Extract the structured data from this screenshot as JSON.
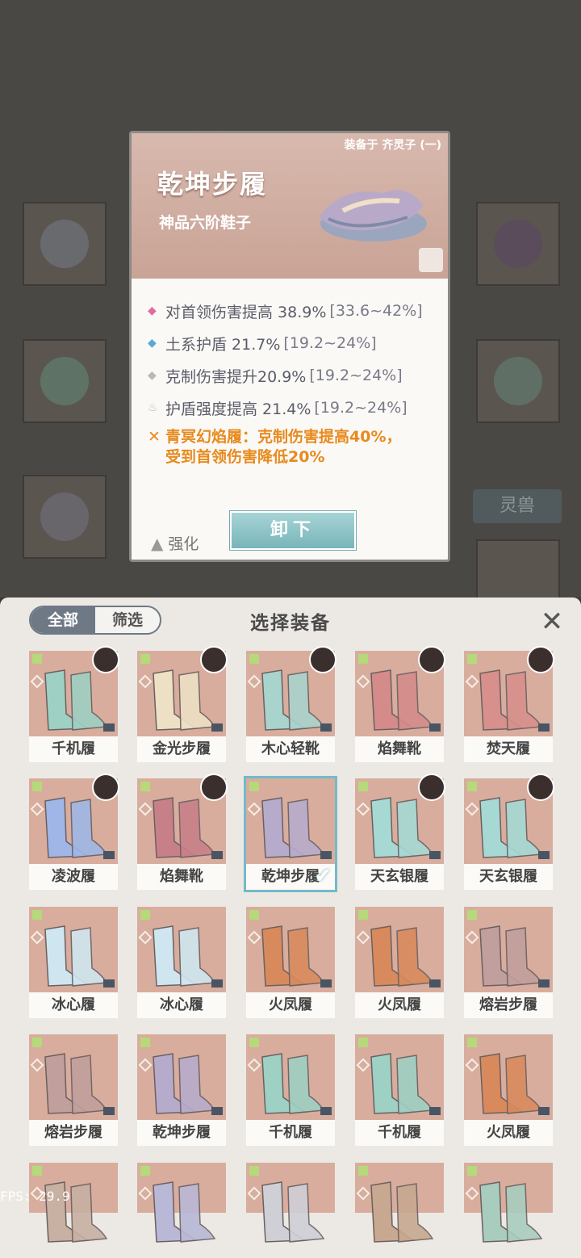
{
  "popup": {
    "equipped_on": "装备于 齐灵子 (一)",
    "item_name": "乾坤步履",
    "item_grade": "神品六阶鞋子",
    "stats": [
      {
        "text": "对首领伤害提高 38.9%",
        "range": "[33.6~42%]",
        "marker_color": "#e36d9a"
      },
      {
        "text": "土系护盾 21.7%",
        "range": "[19.2~24%]",
        "marker_color": "#5aa8d8"
      },
      {
        "text": "克制伤害提升20.9%",
        "range": "[19.2~24%]",
        "marker_color": "#b9b9b9"
      },
      {
        "text": "护盾强度提高 21.4%",
        "range": "[19.2~24%]",
        "marker_color": "#b9b9b9"
      }
    ],
    "set_bonus_line1": "青冥幻焰履：克制伤害提高40%，",
    "set_bonus_line2": "受到首领伤害降低20%",
    "upgrade_label": "强化",
    "unequip_label": "卸下"
  },
  "background": {
    "tab_label": "灵兽"
  },
  "panel": {
    "title": "选择装备",
    "filter_all": "全部",
    "filter_screen": "筛选",
    "close_icon": "close-icon"
  },
  "equipment": [
    {
      "name": "千机履",
      "color": "#9ed0c3"
    },
    {
      "name": "金光步履",
      "color": "#ede0c4"
    },
    {
      "name": "木心轻靴",
      "color": "#a9d3cd"
    },
    {
      "name": "焰舞靴",
      "color": "#d48b8a"
    },
    {
      "name": "焚天履",
      "color": "#d7908c"
    },
    {
      "name": "凌波履",
      "color": "#9fb6e6"
    },
    {
      "name": "焰舞靴",
      "color": "#c88088"
    },
    {
      "name": "乾坤步履",
      "color": "#b7abcb",
      "selected": true
    },
    {
      "name": "天玄银履",
      "color": "#a6d9d4"
    },
    {
      "name": "天玄银履",
      "color": "#a6d9d4"
    },
    {
      "name": "冰心履",
      "color": "#cfe6f0"
    },
    {
      "name": "冰心履",
      "color": "#cfe6f0"
    },
    {
      "name": "火凤履",
      "color": "#d98a5c"
    },
    {
      "name": "火凤履",
      "color": "#d98a5c"
    },
    {
      "name": "熔岩步履",
      "color": "#c19f9c"
    },
    {
      "name": "熔岩步履",
      "color": "#c19f9c"
    },
    {
      "name": "乾坤步履",
      "color": "#b7abcb"
    },
    {
      "name": "千机履",
      "color": "#9ed0c3"
    },
    {
      "name": "千机履",
      "color": "#9ed0c3"
    },
    {
      "name": "火凤履",
      "color": "#d98a5c"
    },
    {
      "name": "",
      "color": "#c8b0a2"
    },
    {
      "name": "",
      "color": "#b9b8d6"
    },
    {
      "name": "",
      "color": "#cfcfd6"
    },
    {
      "name": "",
      "color": "#c8a890"
    },
    {
      "name": "",
      "color": "#a8cdbf"
    }
  ],
  "fps_text": "FPS: 29.9"
}
